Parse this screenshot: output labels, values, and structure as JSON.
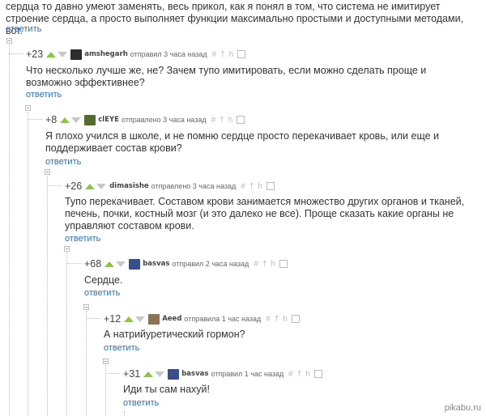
{
  "top": {
    "text": "сердца то давно умеют заменять, весь прикол, как я понял в том, что система не имитирует строение сердца, а просто выполняет функции максимально простыми и доступными методами, вот.",
    "reply": "ответить"
  },
  "comments": [
    {
      "rating": "+23",
      "author": "amshegarh",
      "meta": "отправил 3 часа назад",
      "text": "Что несколько лучше же, не? Зачем тупо имитировать, если можно сделать проще и возможно эффективнее?",
      "reply": "ответить"
    },
    {
      "rating": "+8",
      "author": "clEYE",
      "meta": "отправлено 3 часа назад",
      "text": "Я плохо учился в школе, и не помню сердце просто перекачивает кровь, или еще и поддерживает состав крови?",
      "reply": "ответить"
    },
    {
      "rating": "+26",
      "author": "dimasishe",
      "meta": "отправлено 3 часа назад",
      "text": "Тупо перекачивает. Составом крови занимается множество других органов и тканей, печень, почки, костный мозг (и это далеко не все). Проще сказать какие органы не управляют составом крови.",
      "reply": "ответить"
    },
    {
      "rating": "+68",
      "author": "basvas",
      "meta": "отправил 2 часа назад",
      "text": "Сердце.",
      "reply": "ответить"
    },
    {
      "rating": "+12",
      "author": "Aeed",
      "meta": "отправила 1 час назад",
      "text": "А натрийуретический гормон?",
      "reply": "ответить"
    },
    {
      "rating": "+31",
      "author": "basvas",
      "meta": "отправил 1 час назад",
      "text": "Иди ты сам нахуй!",
      "reply": "ответить"
    }
  ],
  "icons": {
    "hash": "#",
    "pin": "†",
    "link": "h"
  },
  "watermark": "pikabu.ru",
  "colors": {
    "up_arrow": "#8cc63f",
    "down_arrow": "#c8c8c8",
    "link": "#2a6fba"
  }
}
